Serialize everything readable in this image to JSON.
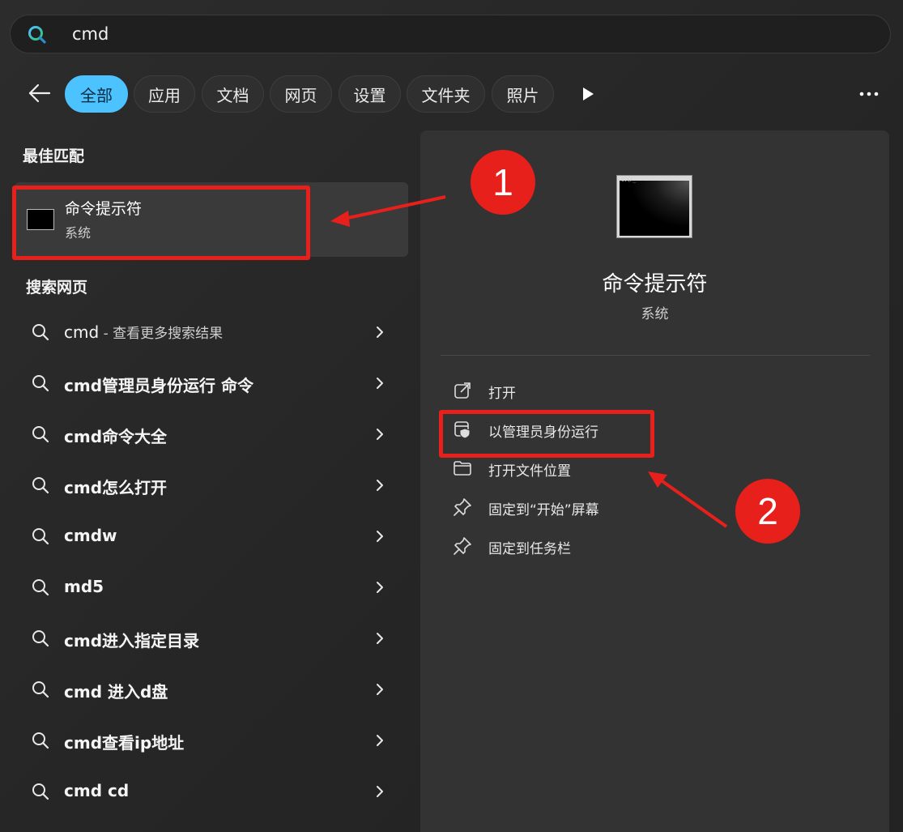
{
  "search": {
    "query": "cmd"
  },
  "filters": {
    "chips": [
      {
        "label": "全部",
        "active": true
      },
      {
        "label": "应用",
        "active": false
      },
      {
        "label": "文档",
        "active": false
      },
      {
        "label": "网页",
        "active": false
      },
      {
        "label": "设置",
        "active": false
      },
      {
        "label": "文件夹",
        "active": false
      },
      {
        "label": "照片",
        "active": false
      }
    ]
  },
  "best_match": {
    "heading": "最佳匹配",
    "app_name": "命令提示符",
    "app_type": "系统"
  },
  "web_search": {
    "heading": "搜索网页",
    "items": [
      {
        "bold": "",
        "light": "cmd",
        "suffix": " - 查看更多搜索结果"
      },
      {
        "bold": "cmd管理员身份运行 命令",
        "light": "",
        "suffix": ""
      },
      {
        "bold": "cmd命令大全",
        "light": "",
        "suffix": ""
      },
      {
        "bold": "cmd怎么打开",
        "light": "",
        "suffix": ""
      },
      {
        "bold": "cmdw",
        "light": "",
        "suffix": ""
      },
      {
        "bold": "md5",
        "light": "",
        "suffix": ""
      },
      {
        "bold": "cmd进入指定目录",
        "light": "",
        "suffix": ""
      },
      {
        "bold": "cmd 进入d盘",
        "light": "",
        "suffix": ""
      },
      {
        "bold": "cmd查看ip地址",
        "light": "",
        "suffix": ""
      },
      {
        "bold": "cmd cd",
        "light": "",
        "suffix": ""
      }
    ]
  },
  "detail": {
    "icon_prompt": "C:\\>_",
    "title": "命令提示符",
    "subtitle": "系统",
    "actions": [
      {
        "label": "打开",
        "icon": "open-external-icon"
      },
      {
        "label": "以管理员身份运行",
        "icon": "shield-icon"
      },
      {
        "label": "打开文件位置",
        "icon": "folder-icon"
      },
      {
        "label": "固定到“开始”屏幕",
        "icon": "pin-icon"
      },
      {
        "label": "固定到任务栏",
        "icon": "pin-icon"
      }
    ]
  },
  "annotations": {
    "badge1": "1",
    "badge2": "2"
  },
  "colors": {
    "accent": "#4cc2ff",
    "annotation": "#e8201b"
  }
}
